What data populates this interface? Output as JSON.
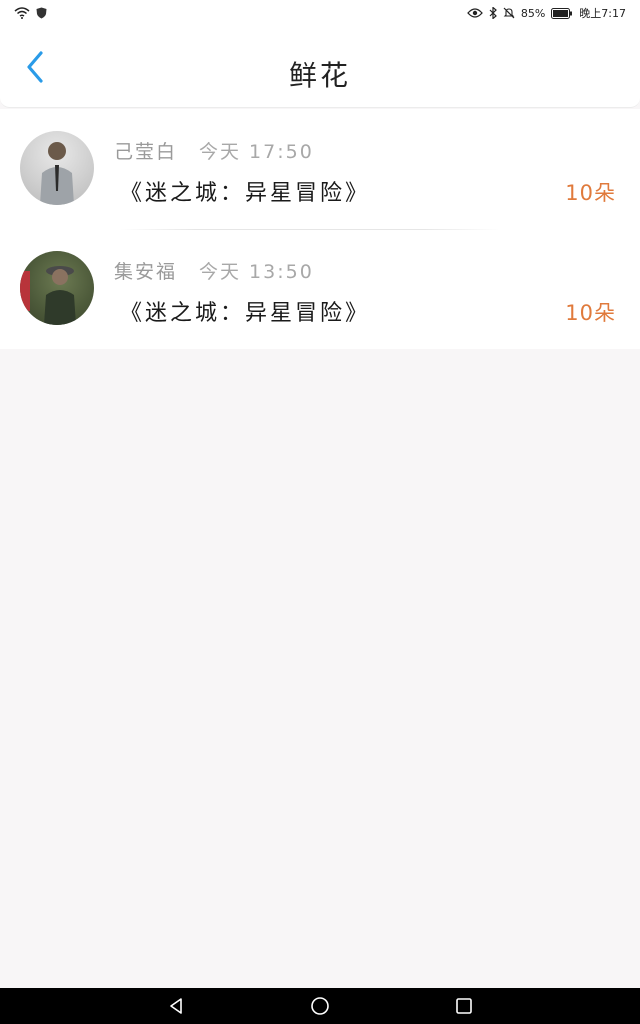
{
  "status": {
    "battery": "85%",
    "time": "晚上7:17"
  },
  "header": {
    "title": "鲜花"
  },
  "items": [
    {
      "name": "己莹白",
      "time": "今天 17:50",
      "book": "《迷之城：异星冒险》",
      "amount": "10朵"
    },
    {
      "name": "集安福",
      "time": "今天 13:50",
      "book": "《迷之城：异星冒险》",
      "amount": "10朵"
    }
  ],
  "colors": {
    "accent": "#2a9be8",
    "amount": "#e07a3c",
    "background": "#f8f6f7"
  }
}
